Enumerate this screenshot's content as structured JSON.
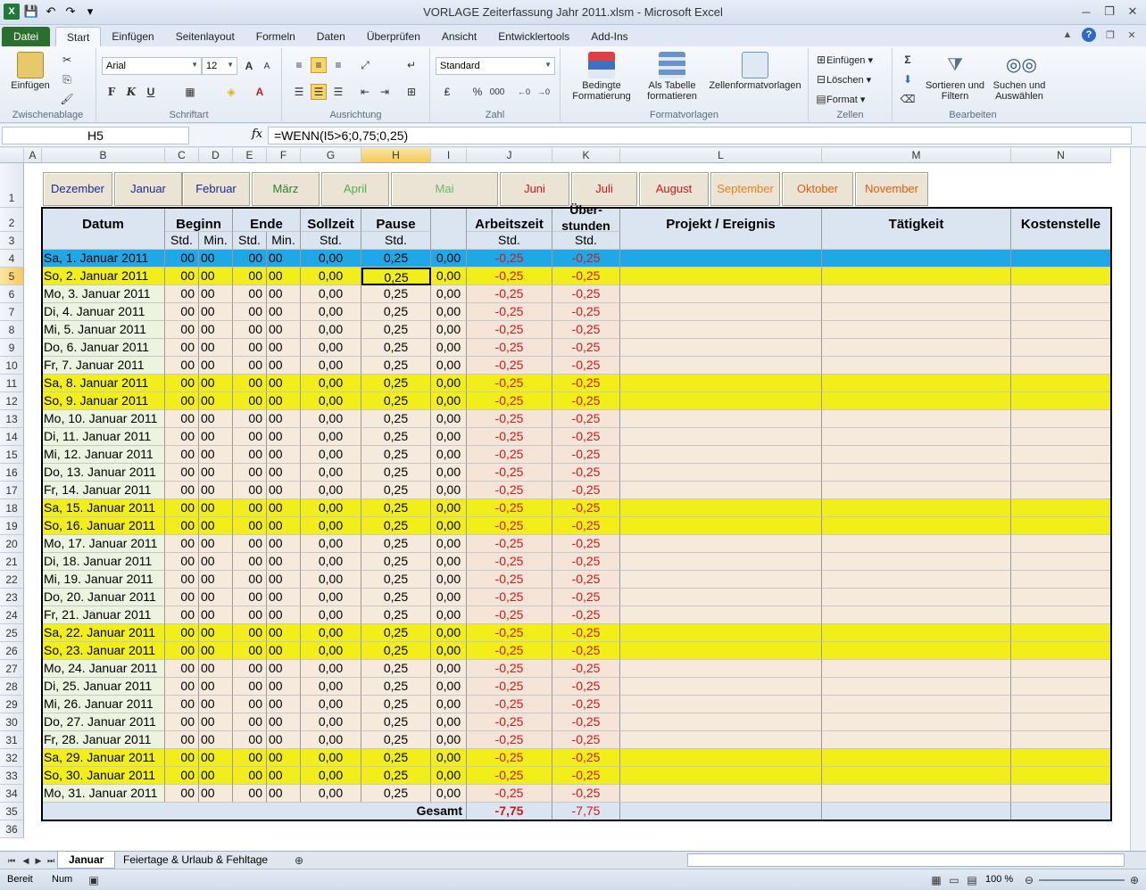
{
  "window": {
    "title": "VORLAGE Zeiterfassung Jahr 2011.xlsm  -  Microsoft Excel"
  },
  "ribbon": {
    "tabs": [
      "Datei",
      "Start",
      "Einfügen",
      "Seitenlayout",
      "Formeln",
      "Daten",
      "Überprüfen",
      "Ansicht",
      "Entwicklertools",
      "Add-Ins"
    ],
    "active_tab": "Start",
    "clipboard": {
      "paste": "Einfügen",
      "label": "Zwischenablage"
    },
    "font": {
      "name": "Arial",
      "size": "12",
      "label": "Schriftart",
      "bold": "F",
      "italic": "K",
      "underline": "U"
    },
    "alignment": {
      "label": "Ausrichtung"
    },
    "number": {
      "format": "Standard",
      "label": "Zahl",
      "percent": "%",
      "thousands": "000"
    },
    "styles": {
      "conditional": "Bedingte Formatierung",
      "as_table": "Als Tabelle formatieren",
      "cell_styles": "Zellenformatvorlagen",
      "label": "Formatvorlagen"
    },
    "cells": {
      "insert": "Einfügen",
      "delete": "Löschen",
      "format": "Format",
      "label": "Zellen"
    },
    "editing": {
      "sort": "Sortieren und Filtern",
      "find": "Suchen und Auswählen",
      "label": "Bearbeiten"
    }
  },
  "formula_bar": {
    "name_box": "H5",
    "fx": "fx",
    "formula": "=WENN(I5>6;0,75;0,25)"
  },
  "columns": [
    "A",
    "B",
    "C",
    "D",
    "E",
    "F",
    "G",
    "H",
    "I",
    "J",
    "K",
    "L",
    "M",
    "N"
  ],
  "months": [
    {
      "label": "Dezember",
      "color": "#1a2aa0"
    },
    {
      "label": "Januar",
      "color": "#1a2aa0"
    },
    {
      "label": "Februar",
      "color": "#1a2aa0"
    },
    {
      "label": "März",
      "color": "#2e7d32"
    },
    {
      "label": "April",
      "color": "#4caf50"
    },
    {
      "label": "Mai",
      "color": "#66bb6a"
    },
    {
      "label": "Juni",
      "color": "#d01818"
    },
    {
      "label": "Juli",
      "color": "#d01818"
    },
    {
      "label": "August",
      "color": "#d01818"
    },
    {
      "label": "September",
      "color": "#f08020"
    },
    {
      "label": "Oktober",
      "color": "#e06010"
    },
    {
      "label": "November",
      "color": "#e06010"
    }
  ],
  "headers": {
    "datum": "Datum",
    "beginn": "Beginn",
    "ende": "Ende",
    "sollzeit": "Sollzeit",
    "pause": "Pause",
    "arbeitszeit": "Arbeitszeit",
    "ueber1": "Über-",
    "ueber2": "stunden",
    "projekt": "Projekt / Ereignis",
    "taetigkeit": "Tätigkeit",
    "kostenstelle": "Kostenstelle",
    "std": "Std.",
    "min": "Min."
  },
  "days": [
    "Sa, 1. Januar 2011",
    "So, 2. Januar 2011",
    "Mo, 3. Januar 2011",
    "Di, 4. Januar 2011",
    "Mi, 5. Januar 2011",
    "Do, 6. Januar 2011",
    "Fr, 7. Januar 2011",
    "Sa, 8. Januar 2011",
    "So, 9. Januar 2011",
    "Mo, 10. Januar 2011",
    "Di, 11. Januar 2011",
    "Mi, 12. Januar 2011",
    "Do, 13. Januar 2011",
    "Fr, 14. Januar 2011",
    "Sa, 15. Januar 2011",
    "So, 16. Januar 2011",
    "Mo, 17. Januar 2011",
    "Di, 18. Januar 2011",
    "Mi, 19. Januar 2011",
    "Do, 20. Januar 2011",
    "Fr, 21. Januar 2011",
    "Sa, 22. Januar 2011",
    "So, 23. Januar 2011",
    "Mo, 24. Januar 2011",
    "Di, 25. Januar 2011",
    "Mi, 26. Januar 2011",
    "Do, 27. Januar 2011",
    "Fr, 28. Januar 2011",
    "Sa, 29. Januar 2011",
    "So, 30. Januar 2011",
    "Mo, 31. Januar 2011"
  ],
  "row_values": {
    "hh": "00",
    "mm": "00",
    "soll": "0,00",
    "pause": "0,25",
    "i": "0,00",
    "arbeit": "-0,25",
    "ueber": "-0,25"
  },
  "totals": {
    "label": "Gesamt",
    "arbeit": "-7,75",
    "ueber": "-7,75"
  },
  "sheet_tabs": [
    "Januar",
    "Feiertage & Urlaub & Fehltage"
  ],
  "status": {
    "ready": "Bereit",
    "num": "Num",
    "zoom": "100 %"
  }
}
